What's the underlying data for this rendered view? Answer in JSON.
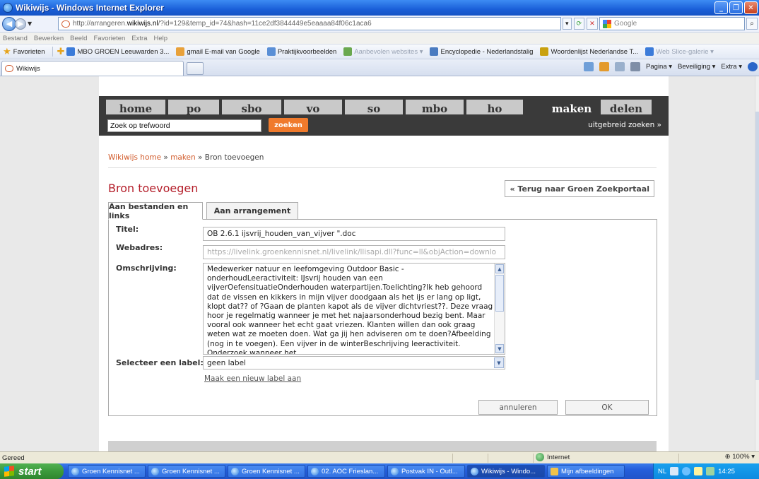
{
  "window": {
    "title": "Wikiwijs - Windows Internet Explorer"
  },
  "address": {
    "url_prefix": "http://arrangeren.",
    "url_domain": "wikiwijs.nl",
    "url_suffix": "/?id=129&temp_id=74&hash=11ce2df3844449e5eaaaa84f06c1aca6",
    "search_placeholder": "Google"
  },
  "menu": [
    "Bestand",
    "Bewerken",
    "Beeld",
    "Favorieten",
    "Extra",
    "Help"
  ],
  "favorites": {
    "label": "Favorieten",
    "items": [
      {
        "label": "MBO GROEN Leeuwarden 3...",
        "color": "#3b7bd9",
        "dim": false
      },
      {
        "label": "gmail E-mail van Google",
        "color": "#e8a13a",
        "dim": false
      },
      {
        "label": "Praktijkvoorbeelden",
        "color": "#5a8fd6",
        "dim": false
      },
      {
        "label": "Aanbevolen websites ▾",
        "color": "#6aa84f",
        "dim": true
      },
      {
        "label": "Encyclopedie - Nederlandstalig",
        "color": "#4a7bc0",
        "dim": false
      },
      {
        "label": "Woordenlijst Nederlandse T...",
        "color": "#c9a10f",
        "dim": false
      },
      {
        "label": "Web Slice-galerie ▾",
        "color": "#3b7bd9",
        "dim": true
      }
    ]
  },
  "tab": {
    "label": "Wikiwijs"
  },
  "commandbar": {
    "pagina": "Pagina ▾",
    "beveiliging": "Beveiliging ▾",
    "extra": "Extra ▾"
  },
  "site": {
    "nav": [
      "home",
      "po",
      "sbo",
      "vo",
      "so",
      "mbo",
      "ho"
    ],
    "nav_right": {
      "maken": "maken",
      "delen": "delen"
    },
    "search": {
      "value": "Zoek op trefwoord",
      "button": "zoeken",
      "advanced": "uitgebreid zoeken »"
    },
    "breadcrumb": {
      "home": "Wikiwijs home",
      "sep": " » ",
      "maken": "maken",
      "current": "Bron toevoegen"
    },
    "page_title": "Bron toevoegen",
    "back_button": "« Terug naar Groen Zoekportaal",
    "form_tabs": [
      "Aan bestanden en links",
      "Aan arrangement"
    ],
    "form": {
      "titel_label": "Titel:",
      "titel_value": "OB 2.6.1 ijsvrij_houden_van_vijver \".doc",
      "webadres_label": "Webadres:",
      "webadres_value": "https://livelink.groenkennisnet.nl/livelink/llisapi.dll?func=ll&objAction=downlo",
      "omschrijving_label": "Omschrijving:",
      "omschrijving_value": "Medewerker natuur en leefomgeving Outdoor Basic - onderhoudLeeractiviteit: IJsvrij houden van een vijverOefensituatieOnderhouden waterpartijen.Toelichting?Ik heb gehoord dat de vissen en kikkers in mijn vijver doodgaan als het ijs er lang op ligt, klopt dat?? of ?Gaan de planten kapot als de vijver dichtvriest??. Deze vraag hoor je regelmatig wanneer je met het najaarsonderhoud bezig bent. Maar vooral ook wanneer het echt gaat vriezen. Klanten willen dan ook graag weten wat ze moeten doen. Wat ga jij hen adviseren om te doen?Afbeelding (nog in te voegen). Een vijver in de winterBeschrijving leeractiviteit. Onderzoek wanneer het",
      "label_label": "Selecteer een label:",
      "label_value": "geen label",
      "new_label_link": "Maak een nieuw label aan",
      "cancel": "annuleren",
      "ok": "OK"
    }
  },
  "status": {
    "text": "Gereed",
    "zone": "Internet",
    "zoom": "100%"
  },
  "taskbar": {
    "start": "start",
    "items": [
      {
        "label": "Groen Kennisnet ...",
        "active": false
      },
      {
        "label": "Groen Kennisnet ...",
        "active": false
      },
      {
        "label": "Groen Kennisnet ...",
        "active": false
      },
      {
        "label": "02. AOC Frieslan...",
        "active": false
      },
      {
        "label": "Postvak IN - Outl...",
        "active": false
      },
      {
        "label": "Wikiwijs - Windo...",
        "active": true
      },
      {
        "label": "Mijn afbeeldingen",
        "active": false
      }
    ],
    "lang": "NL",
    "clock": "14:25"
  }
}
